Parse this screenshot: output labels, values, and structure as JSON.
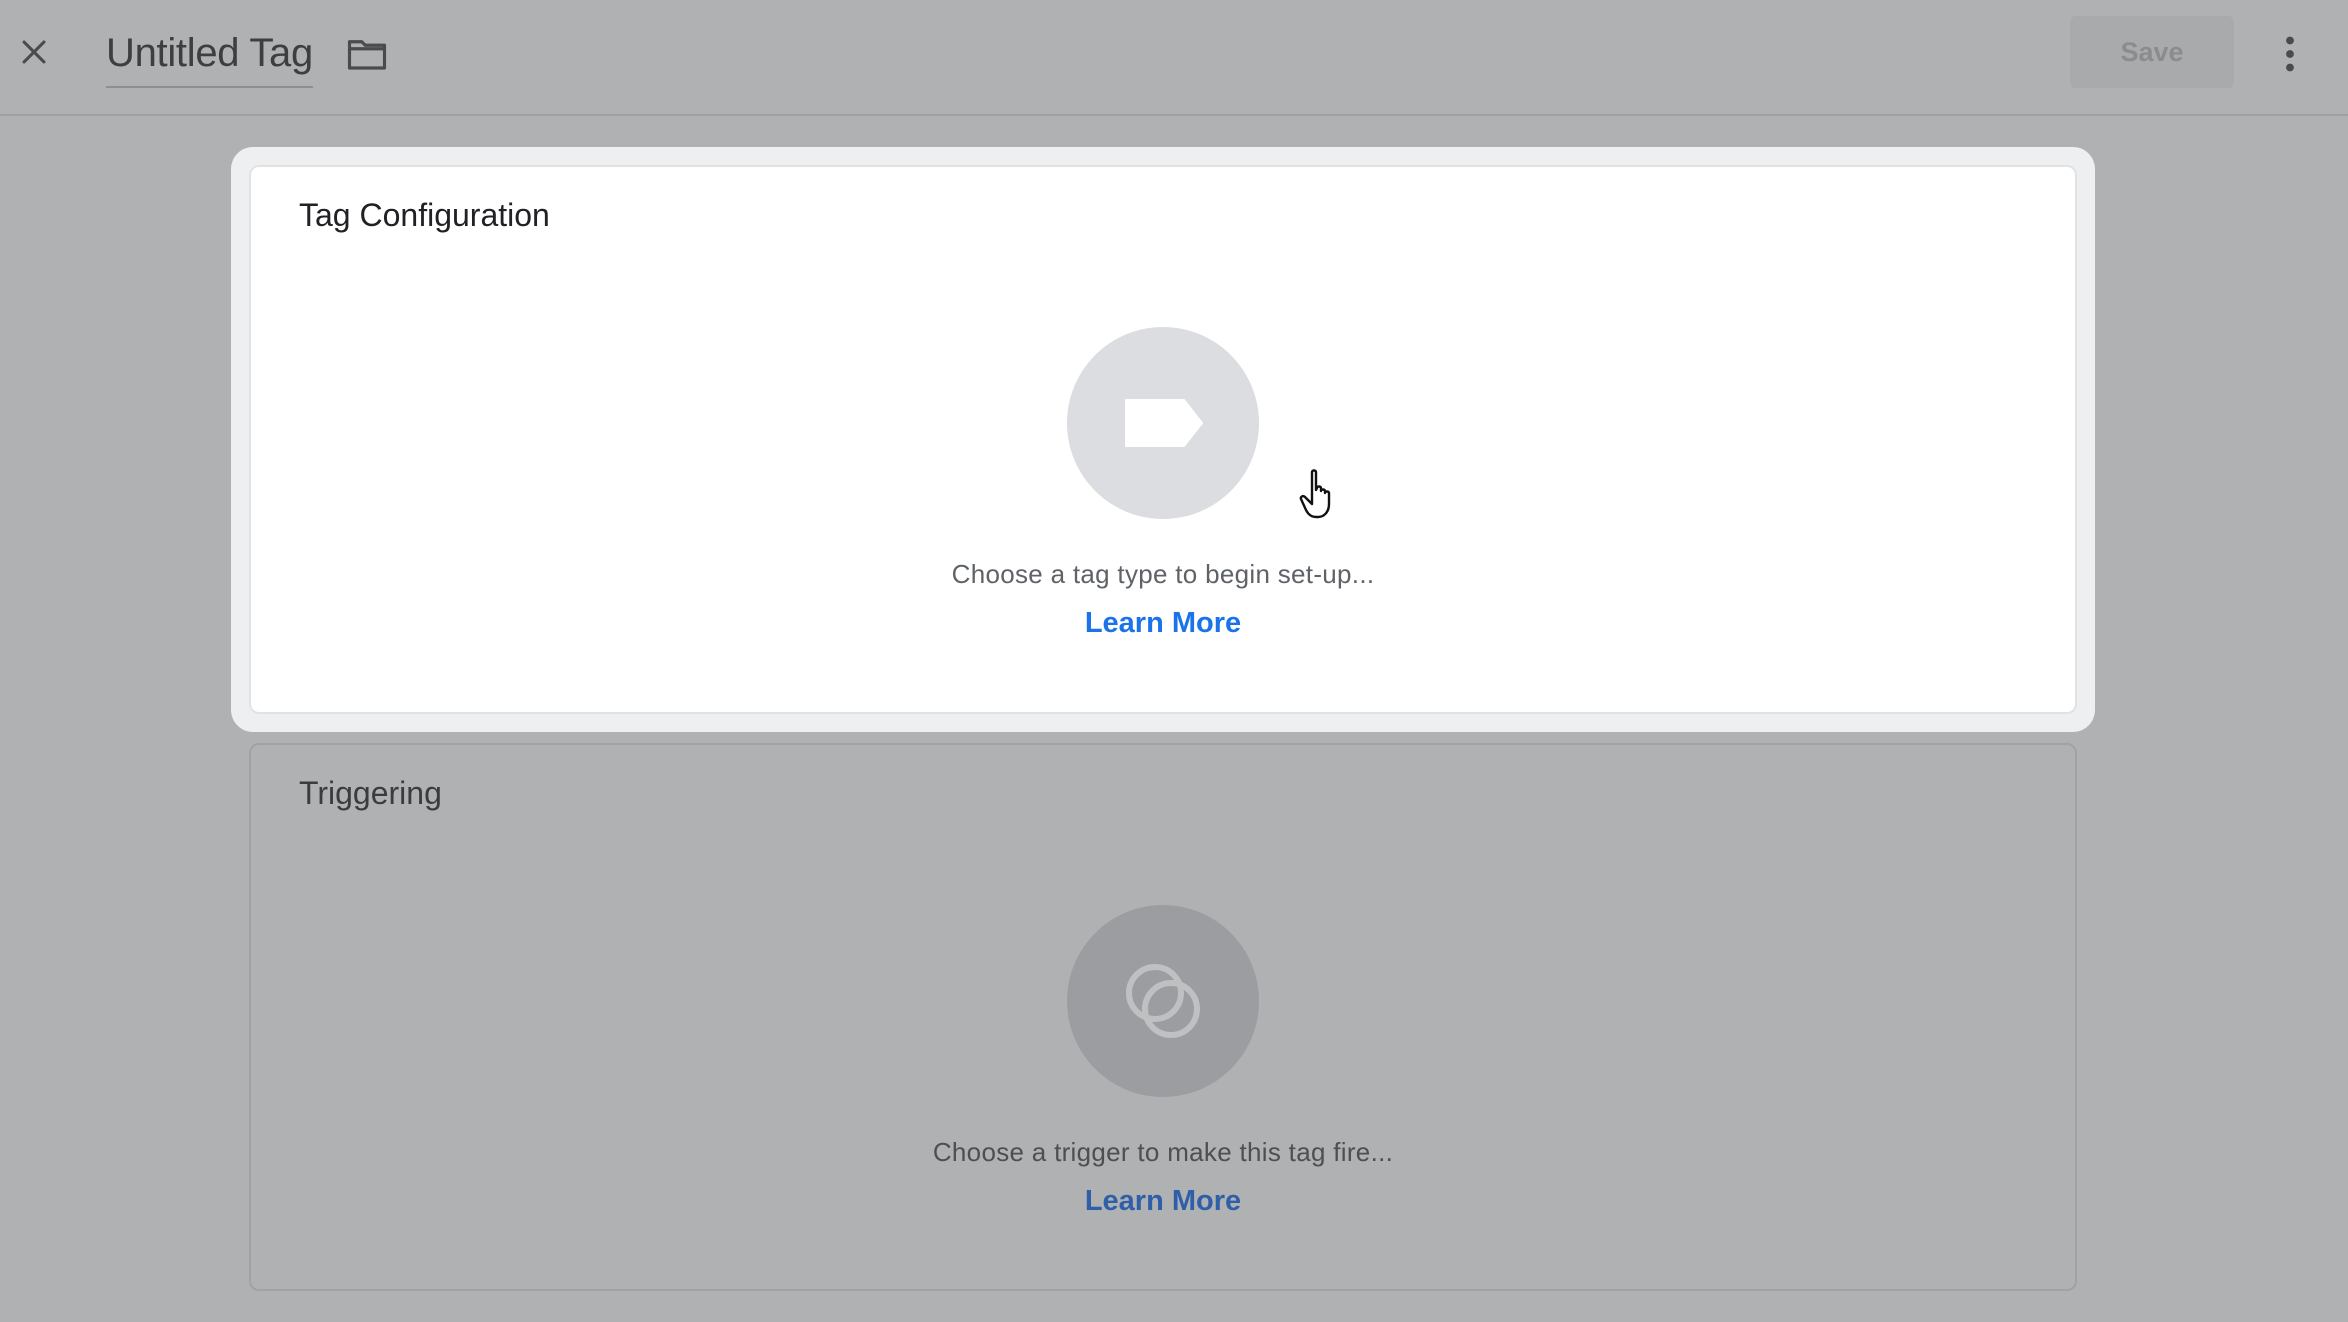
{
  "header": {
    "title": "Untitled Tag",
    "save_label": "Save",
    "icons": {
      "close": "close-icon",
      "folder": "folder-icon",
      "more": "more-vert-icon"
    }
  },
  "tag_configuration": {
    "title": "Tag Configuration",
    "hint": "Choose a tag type to begin set-up...",
    "link_label": "Learn More",
    "icon": "tag-icon"
  },
  "triggering": {
    "title": "Triggering",
    "hint": "Choose a trigger to make this tag fire...",
    "link_label": "Learn More",
    "icon": "trigger-icon"
  },
  "colors": {
    "overlay": "#b0b1b3",
    "link": "#1a73e8",
    "card": "#ffffff"
  }
}
